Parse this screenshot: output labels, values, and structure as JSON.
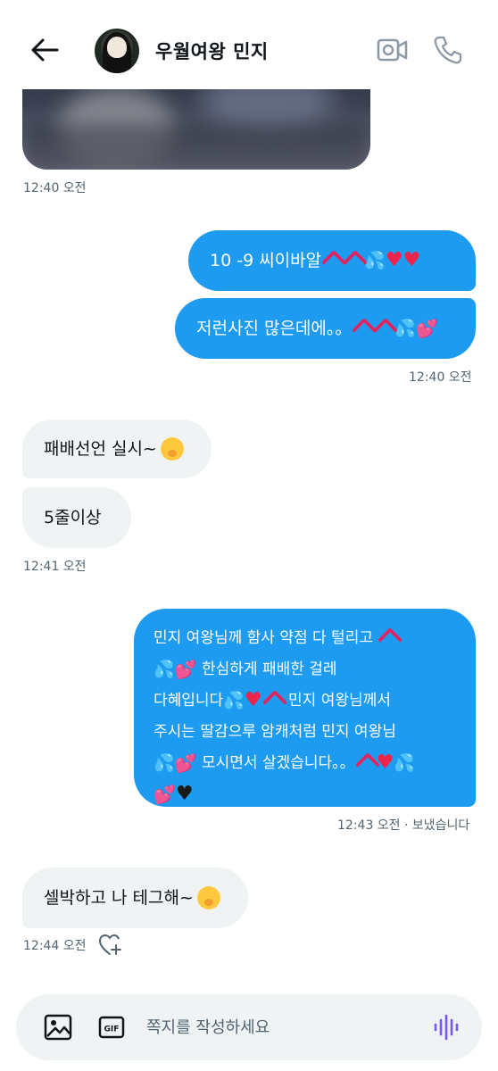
{
  "header": {
    "contact_name": "우월여왕 민지"
  },
  "messages": [
    {
      "id": "photo",
      "type": "image",
      "direction": "incoming"
    },
    {
      "id": "ts1",
      "text": "12:40 오전"
    },
    {
      "id": "out1",
      "text": "10 -9 씨이바알",
      "emojis": [
        "anger-symbol",
        "anger-symbol",
        "sweat-droplets",
        "red-heart",
        "red-heart"
      ]
    },
    {
      "id": "out2",
      "text": "저런사진 많은데에。。",
      "emojis": [
        "anger-symbol",
        "anger-symbol",
        "sweat-droplets",
        "two-hearts"
      ]
    },
    {
      "id": "ts2",
      "text": "12:40 오전"
    },
    {
      "id": "in1",
      "text": "패배선언 실시~",
      "emojis": [
        "face-with-hand-over-mouth"
      ]
    },
    {
      "id": "in2",
      "text": "5줄이상"
    },
    {
      "id": "ts3",
      "text": "12:41 오전"
    },
    {
      "id": "out3",
      "lines": [
        "민지 여왕님께 함사 약점 다 털리고",
        "한심하게 패배한 걸레",
        "다혜입니다",
        "민지 여왕님께서",
        "주시는 딸감으루 암캐처럼 민지 여왕님",
        "모시면서 살겠습니다。。"
      ]
    },
    {
      "id": "ts4",
      "text": "12:43 오전 · 보냈습니다"
    },
    {
      "id": "in3",
      "text": "셀박하고 나 테그해~",
      "emojis": [
        "face-with-hand-over-mouth"
      ]
    },
    {
      "id": "ts5",
      "text": "12:44 오전"
    }
  ],
  "composer": {
    "placeholder": "쪽지를 작성하세요",
    "value": ""
  },
  "colors": {
    "outgoing_bubble": "#1d9bf0",
    "incoming_bubble": "#eff3f4",
    "timestamp": "#536471",
    "voice_icon": "#7856ff"
  },
  "icons": [
    "back-arrow-icon",
    "video-call-icon",
    "phone-icon",
    "add-reaction-heart-icon",
    "image-icon",
    "gif-icon",
    "voice-message-icon"
  ]
}
